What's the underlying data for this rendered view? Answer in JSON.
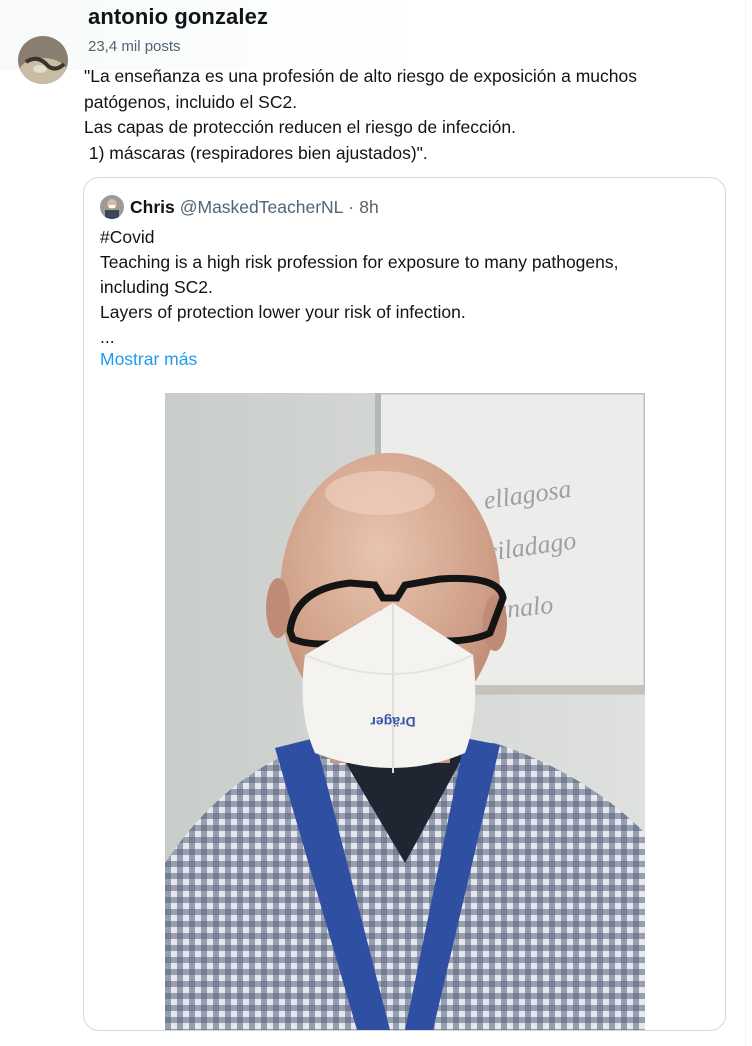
{
  "author": {
    "name": "antonio gonzalez",
    "posts_count": "23,4 mil posts"
  },
  "tweet": {
    "lines": [
      "\"La enseñanza es una profesión de alto riesgo de exposición a muchos",
      "patógenos, incluido el SC2.",
      "Las capas de protección reducen el riesgo de infección.",
      " 1) máscaras (respiradores bien ajustados)\"."
    ]
  },
  "quoted": {
    "name": "Chris",
    "handle": "@MaskedTeacherNL",
    "separator": "·",
    "time": "8h",
    "lines": [
      "#Covid",
      "Teaching is a high risk profession for exposure to many pathogens,",
      "including SC2.",
      "Layers of protection lower your risk of infection.",
      "..."
    ],
    "show_more": "Mostrar más",
    "photo": {
      "mask_brand": "Dräger",
      "whiteboard_words": [
        "ellagosa",
        "ciladago",
        "gnalo"
      ]
    }
  },
  "colors": {
    "link": "#1d9bf0",
    "secondary_text": "#536471",
    "border": "#cfd9de"
  }
}
